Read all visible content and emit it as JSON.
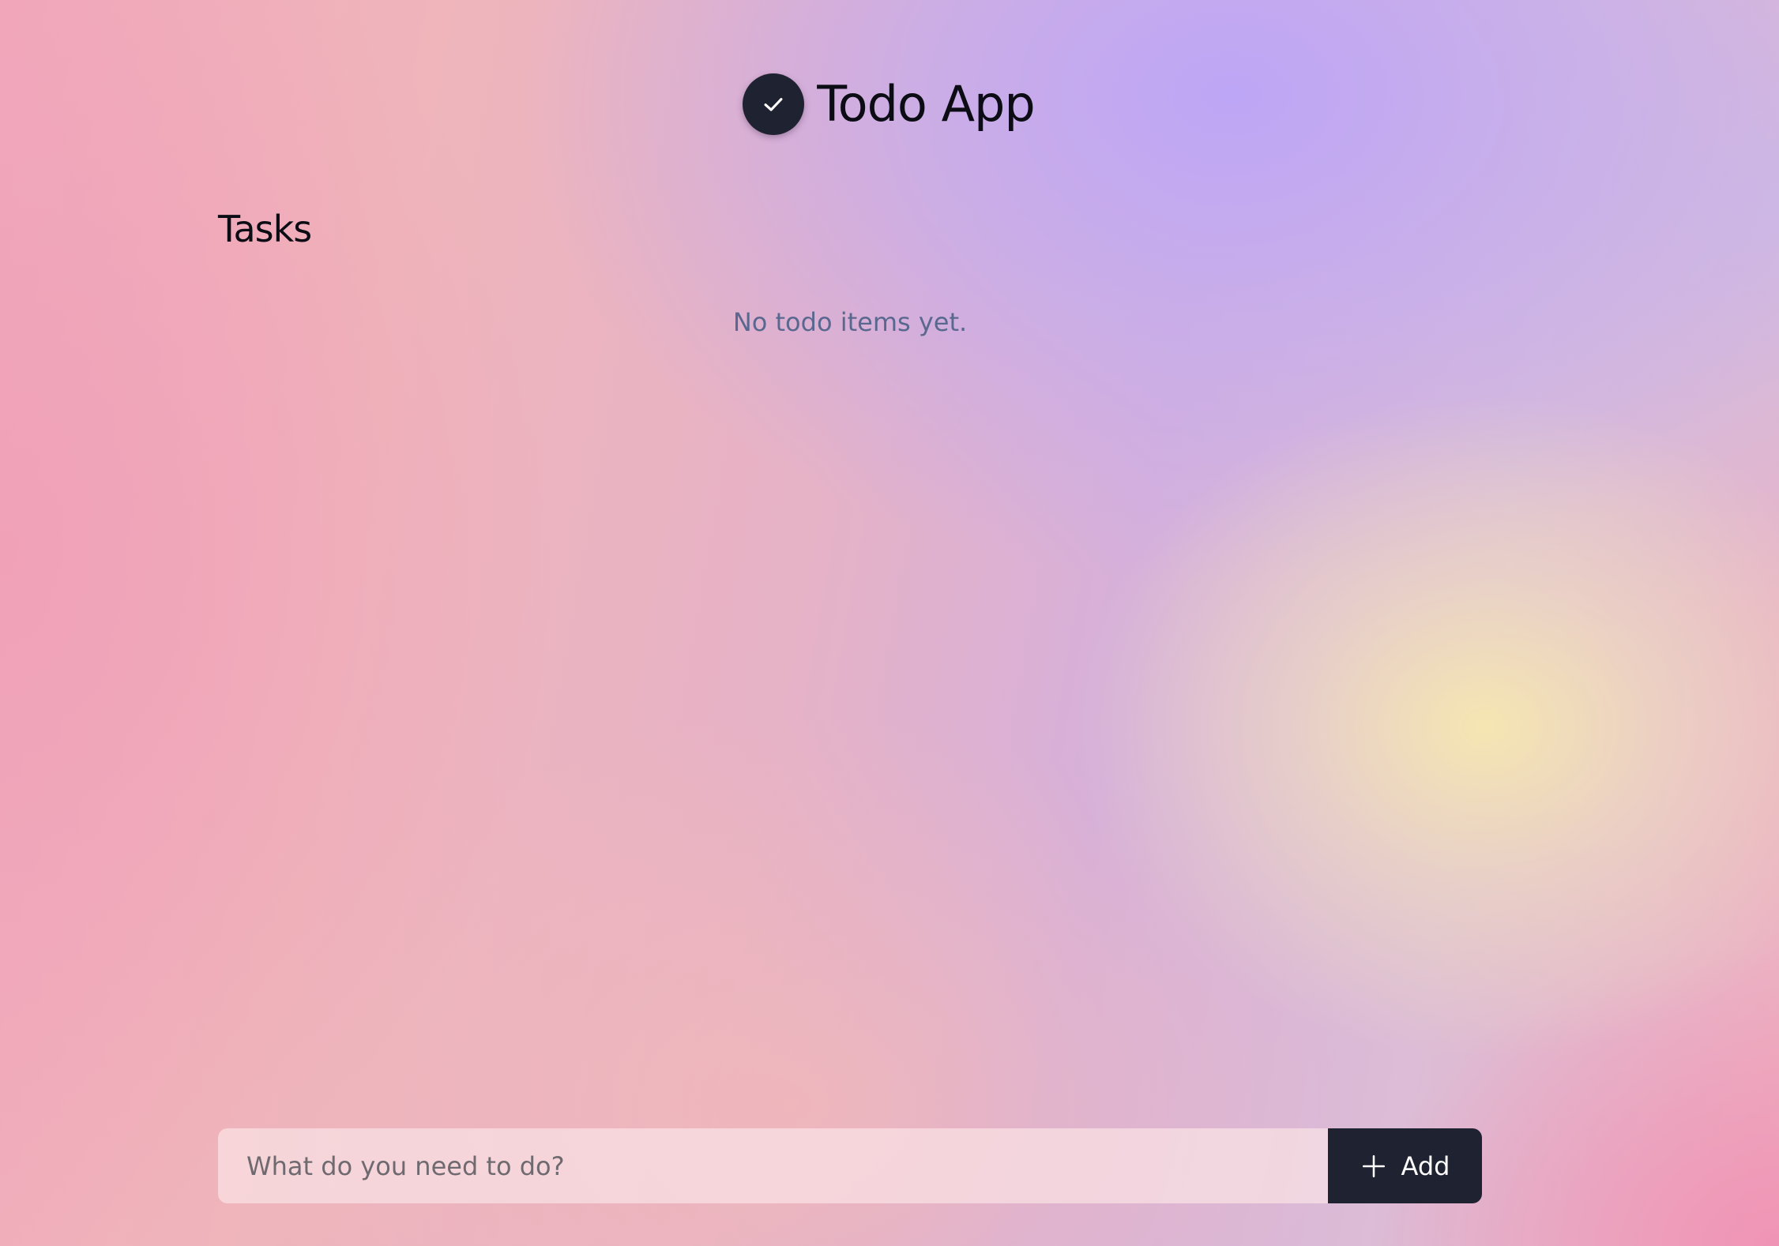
{
  "app": {
    "title": "Todo App",
    "logo_icon": "checkmark-icon"
  },
  "tasks": {
    "heading": "Tasks",
    "empty_message": "No todo items yet.",
    "items": []
  },
  "form": {
    "input_value": "",
    "input_placeholder": "What do you need to do?",
    "add_label": "Add",
    "add_icon": "plus-icon"
  },
  "colors": {
    "accent_dark": "#1f2231",
    "empty_text": "#5a6890",
    "gradient_pink": "#f1a8bb",
    "gradient_purple": "#bea6f6",
    "gradient_yellow": "#f6e8b0"
  }
}
